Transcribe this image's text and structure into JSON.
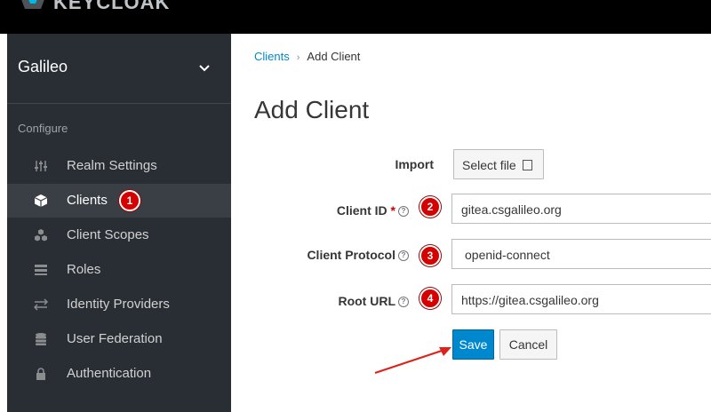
{
  "header": {
    "logo_text": "KEYCLOAK"
  },
  "sidebar": {
    "realm_name": "Galileo",
    "section_label": "Configure",
    "items": [
      {
        "label": "Realm Settings",
        "icon": "sliders-icon"
      },
      {
        "label": "Clients",
        "icon": "cube-icon",
        "active": true
      },
      {
        "label": "Client Scopes",
        "icon": "cubes-icon"
      },
      {
        "label": "Roles",
        "icon": "list-icon"
      },
      {
        "label": "Identity Providers",
        "icon": "exchange-icon"
      },
      {
        "label": "User Federation",
        "icon": "database-icon"
      },
      {
        "label": "Authentication",
        "icon": "lock-icon"
      }
    ]
  },
  "breadcrumb": {
    "parent": "Clients",
    "current": "Add Client"
  },
  "page_title": "Add Client",
  "form": {
    "import_label": "Import",
    "select_file_label": "Select file",
    "client_id_label": "Client ID",
    "client_id_value": "gitea.csgalileo.org",
    "client_protocol_label": "Client Protocol",
    "client_protocol_value": "openid-connect",
    "root_url_label": "Root URL",
    "root_url_value": "https://gitea.csgalileo.org",
    "save_label": "Save",
    "cancel_label": "Cancel"
  },
  "annotations": {
    "badge_1": "1",
    "badge_2": "2",
    "badge_3": "3",
    "badge_4": "4"
  },
  "colors": {
    "accent": "#0088ce",
    "sidebar_bg": "#292e34",
    "badge": "#d50000",
    "arrow": "#e0201a"
  }
}
